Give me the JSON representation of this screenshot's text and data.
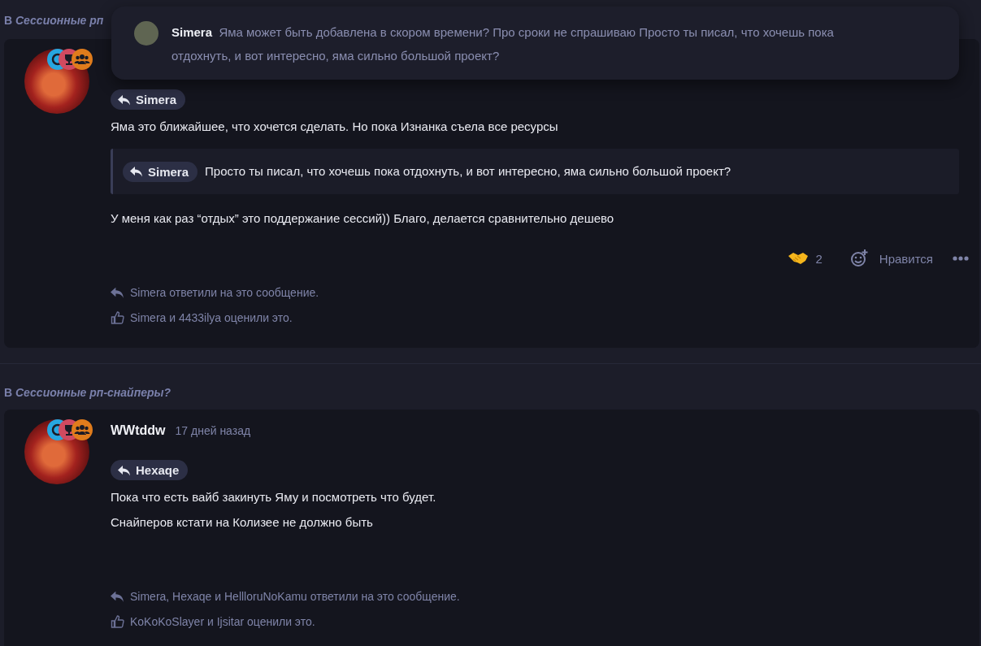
{
  "popup": {
    "author": "Simera",
    "text": "Яма может быть добавлена в скором времени? Про сроки не спрашиваю Просто ты писал, что хочешь пока отдохнуть, и вот интересно, яма сильно большой проект?"
  },
  "sections": [
    {
      "prefix": "В",
      "topic": "Сессионные рп",
      "post": {
        "body": [
          {
            "kind": "reply_pill",
            "text": "Simera"
          },
          {
            "kind": "paragraph",
            "text": "Яма это ближайшее, что хочется сделать. Но пока Изнанка съела все ресурсы"
          },
          {
            "kind": "quote",
            "pill": "Simera",
            "text": "Просто ты писал, что хочешь пока отдохнуть, и вот интересно, яма сильно большой проект?"
          },
          {
            "kind": "paragraph",
            "text": "У меня как раз “отдых” это поддержание сессий)) Благо, делается сравнительно дешево"
          }
        ],
        "reactions": {
          "count": "2",
          "like_label": "Нравится"
        },
        "replies": "Simera ответили на это сообщение.",
        "likes": "Simera и 4433ilya оценили это."
      }
    },
    {
      "prefix": "В",
      "topic": "Сессионные рп-снайперы?",
      "post": {
        "author": "WWtddw",
        "time": "17 дней назад",
        "body": [
          {
            "kind": "reply_pill",
            "text": "Hexaqe"
          },
          {
            "kind": "paragraph",
            "text": "Пока что есть вайб закинуть Яму и посмотреть что будет."
          },
          {
            "kind": "paragraph",
            "text": "Снайперов кстати на Колизее не должно быть"
          }
        ],
        "replies": "Simera, Hexaqe и HellloruNoKamu ответили на это сообщение.",
        "likes": "KoKoKoSlayer и Ijsitar оценили это."
      }
    }
  ]
}
